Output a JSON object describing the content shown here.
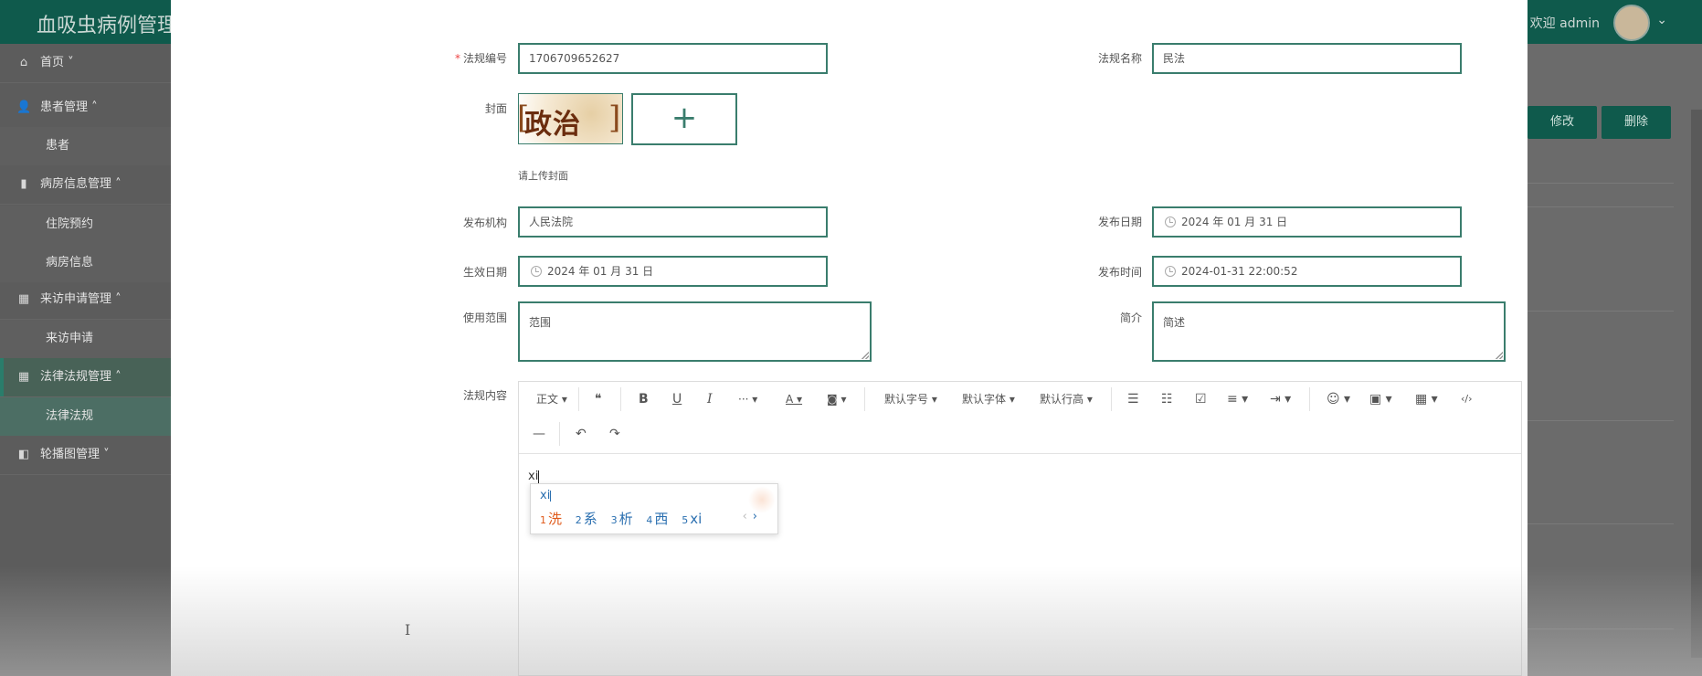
{
  "app": {
    "title": "血吸虫病例管理",
    "welcome": "欢迎 admin",
    "caret": "⌄"
  },
  "sidebar": {
    "items": [
      {
        "icon": "⌂",
        "label": "首页 ˅"
      },
      {
        "icon": "👤",
        "label": "患者管理 ˄"
      },
      {
        "icon": "▮",
        "label": "病房信息管理 ˄"
      },
      {
        "icon": "▦",
        "label": "来访申请管理 ˄"
      },
      {
        "icon": "▦",
        "label": "法律法规管理 ˄"
      },
      {
        "icon": "◧",
        "label": "轮播图管理 ˅"
      }
    ],
    "subs": [
      "患者",
      "住院预约",
      "病房信息",
      "来访申请",
      "法律法规"
    ]
  },
  "background_actions": {
    "edit": "修改",
    "delete": "删除"
  },
  "form": {
    "law_no": {
      "label": "法规编号",
      "required_mark": "*",
      "value": "1706709652627"
    },
    "law_name": {
      "label": "法规名称",
      "value": "民法"
    },
    "cover": {
      "label": "封面",
      "image_text": "政治",
      "bracket_left": "[",
      "bracket_right": "]",
      "add": "+",
      "hint": "请上传封面"
    },
    "issuer": {
      "label": "发布机构",
      "value": "人民法院"
    },
    "publish_date": {
      "label": "发布日期",
      "value": "2024 年 01 月 31 日"
    },
    "effective_date": {
      "label": "生效日期",
      "value": "2024 年 01 月 31 日"
    },
    "publish_time": {
      "label": "发布时间",
      "value": "2024-01-31 22:00:52"
    },
    "scope": {
      "label": "使用范围",
      "value": "范围"
    },
    "intro": {
      "label": "简介",
      "value": "简述"
    },
    "content": {
      "label": "法规内容",
      "value": "xi"
    }
  },
  "editor": {
    "toolbar": {
      "heading": "正文 ▾",
      "quote": "❝",
      "bold": "B",
      "underline": "U",
      "italic": "I",
      "more": "··· ▾",
      "font_color": "A ▾",
      "bg_color": "◙ ▾",
      "font_size": "默认字号 ▾",
      "font_family": "默认字体 ▾",
      "line_height": "默认行高 ▾",
      "bullet_list": "☰",
      "number_list": "☷",
      "todo": "☑",
      "align": "≡ ▾",
      "indent": "⇥ ▾",
      "emoji": "☺ ▾",
      "image": "▣ ▾",
      "table": "▦ ▾",
      "code": "‹/›",
      "divider": "—",
      "undo": "↶",
      "redo": "↷"
    },
    "ime": {
      "composition": "xi",
      "candidates": [
        {
          "n": "1",
          "text": "洗"
        },
        {
          "n": "2",
          "text": "系"
        },
        {
          "n": "3",
          "text": "析"
        },
        {
          "n": "4",
          "text": "西"
        },
        {
          "n": "5",
          "text": "xi"
        }
      ],
      "prev": "‹",
      "next": "›"
    }
  },
  "cursor": "I"
}
